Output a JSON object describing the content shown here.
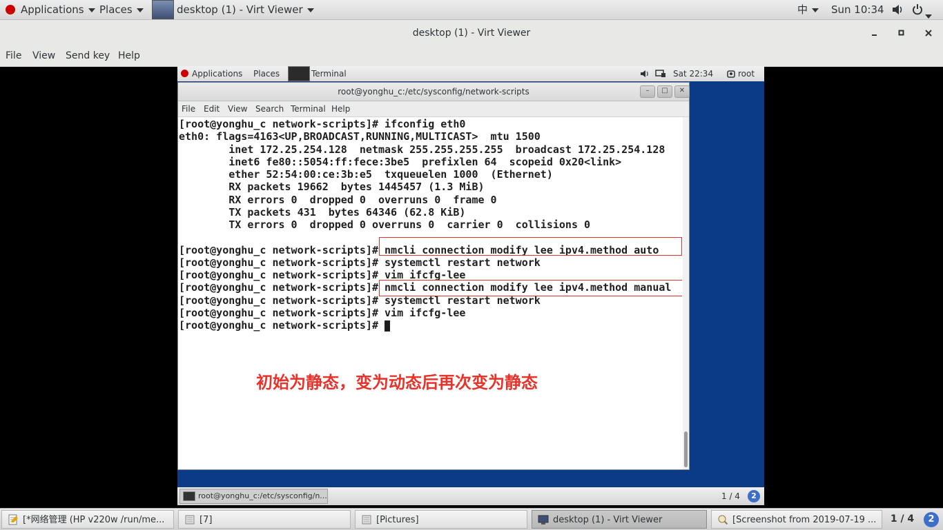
{
  "top_bar": {
    "applications": "Applications",
    "places": "Places",
    "window_title": "desktop (1) - Virt Viewer",
    "input_method": "中",
    "clock": "Sun 10:34"
  },
  "virt_viewer": {
    "title": "desktop (1) - Virt Viewer",
    "menu": [
      "File",
      "View",
      "Send key",
      "Help"
    ]
  },
  "guest": {
    "top_bar": {
      "applications": "Applications",
      "places": "Places",
      "terminal": "Terminal",
      "clock": "Sat 22:34",
      "user": "root"
    },
    "terminal": {
      "title": "root@yonghu_c:/etc/sysconfig/network-scripts",
      "menu": [
        "File",
        "Edit",
        "View",
        "Search",
        "Terminal",
        "Help"
      ],
      "lines": [
        "[root@yonghu_c network-scripts]# ifconfig eth0",
        "eth0: flags=4163<UP,BROADCAST,RUNNING,MULTICAST>  mtu 1500",
        "        inet 172.25.254.128  netmask 255.255.255.255  broadcast 172.25.254.128",
        "        inet6 fe80::5054:ff:fece:3be5  prefixlen 64  scopeid 0x20<link>",
        "        ether 52:54:00:ce:3b:e5  txqueuelen 1000  (Ethernet)",
        "        RX packets 19662  bytes 1445457 (1.3 MiB)",
        "        RX errors 0  dropped 0  overruns 0  frame 0",
        "        TX packets 431  bytes 64346 (62.8 KiB)",
        "        TX errors 0  dropped 0 overruns 0  carrier 0  collisions 0",
        "",
        "[root@yonghu_c network-scripts]# nmcli connection modify lee ipv4.method auto",
        "[root@yonghu_c network-scripts]# systemctl restart network",
        "[root@yonghu_c network-scripts]# vim ifcfg-lee",
        "[root@yonghu_c network-scripts]# nmcli connection modify lee ipv4.method manual",
        "[root@yonghu_c network-scripts]# systemctl restart network",
        "[root@yonghu_c network-scripts]# vim ifcfg-lee",
        "[root@yonghu_c network-scripts]# "
      ],
      "annotation": "初始为静态，变为动态后再次变为静态"
    },
    "taskbar": {
      "task": "root@yonghu_c:/etc/sysconfig/n...",
      "workspace": "1 / 4"
    }
  },
  "taskbar": {
    "tasks": [
      "[*网络管理 (HP v220w /run/me...",
      "[7]",
      "[Pictures]",
      "desktop (1) - Virt Viewer",
      "[Screenshot from 2019-07-19 ..."
    ],
    "workspace": "1 / 4"
  },
  "colors": {
    "guest_desktop": "#0b3a86",
    "annotation": "#e8332b",
    "highlight_box": "#e0302a",
    "workspace_badge": "#3e6fc8"
  },
  "icons": {
    "top_bar": [
      "redhat-logo-icon",
      "caret-down-icon",
      "volume-icon",
      "power-icon"
    ],
    "guest_top_bar": [
      "redhat-logo-icon",
      "terminal-icon",
      "volume-icon",
      "display-icon",
      "user-icon"
    ]
  }
}
